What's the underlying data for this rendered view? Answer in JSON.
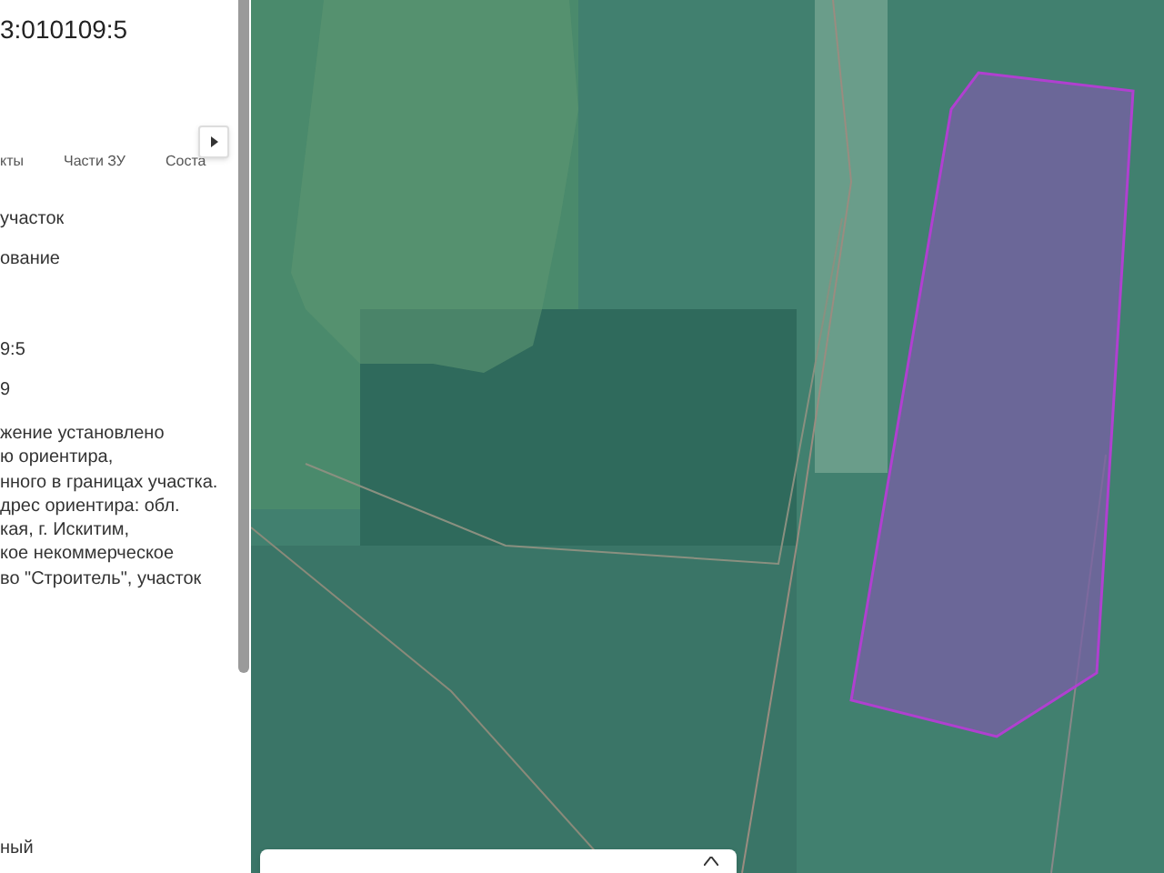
{
  "panel": {
    "title": "3:010109:5",
    "tabs": [
      {
        "label": "кты",
        "selected": false
      },
      {
        "label": "Части ЗУ",
        "selected": false
      },
      {
        "label": "Соста",
        "selected": false
      }
    ],
    "fields": [
      {
        "kind": "line",
        "text": "участок"
      },
      {
        "kind": "line",
        "text": "ование"
      },
      {
        "kind": "gap"
      },
      {
        "kind": "line",
        "text": "9:5"
      },
      {
        "kind": "line",
        "text": "9"
      },
      {
        "kind": "paragraph",
        "lines": [
          "жение установлено",
          "ю ориентира,",
          "нного в границах участка.",
          "дрес ориентира: обл.",
          "кая, г. Искитим,",
          "кое некоммерческое",
          "во \"Строитель\", участок"
        ]
      },
      {
        "kind": "tail",
        "text": "ный"
      }
    ]
  }
}
